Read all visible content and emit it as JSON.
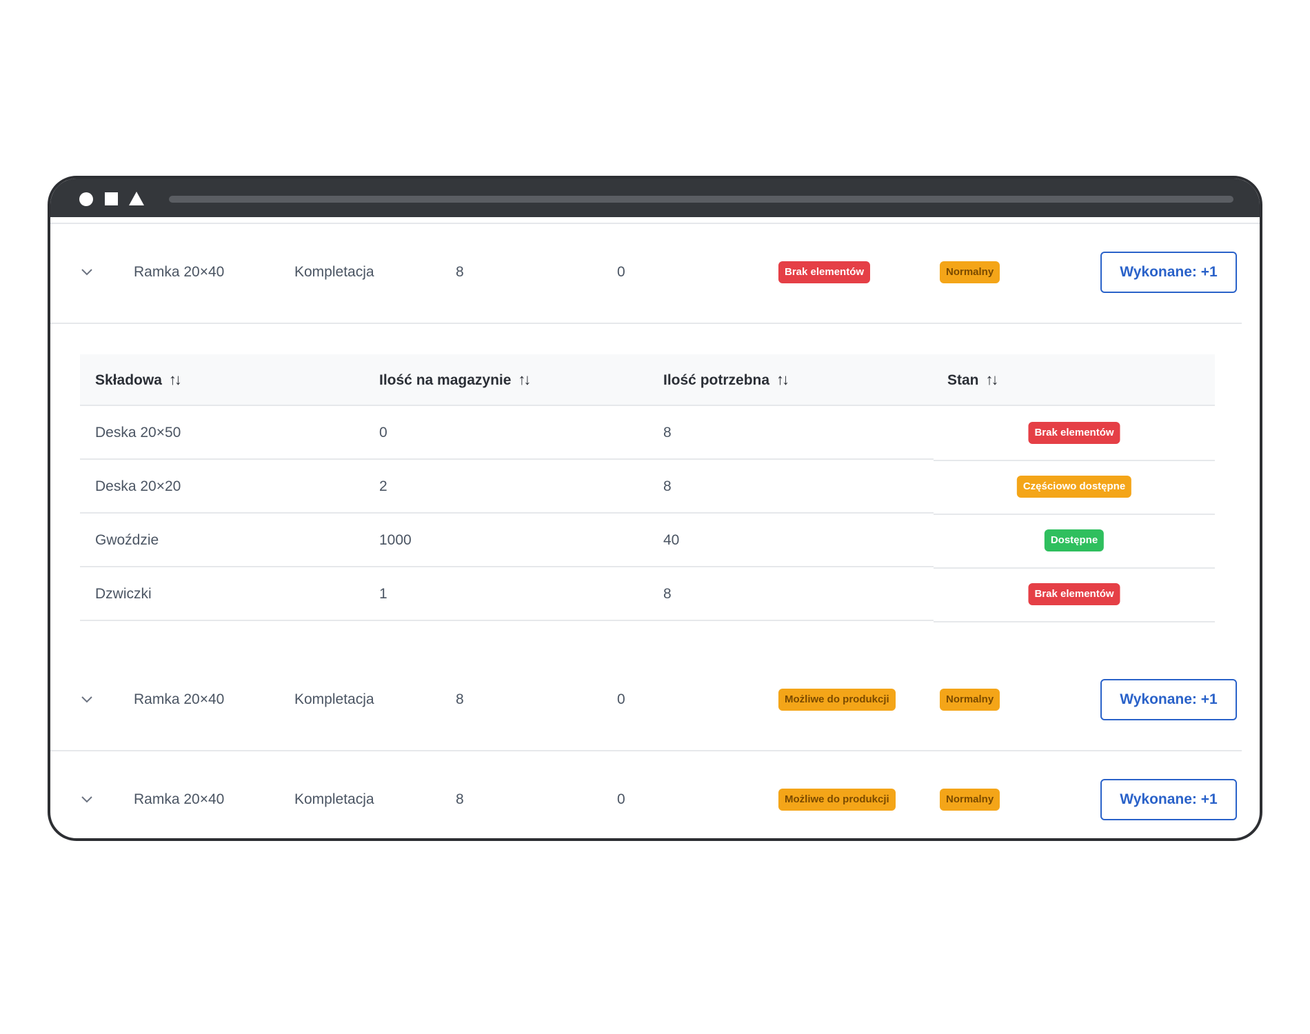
{
  "orders": [
    {
      "name": "Ramka 20×40",
      "type": "Kompletacja",
      "qty": "8",
      "done": "0",
      "status": "Brak elementów",
      "status_color": "#e53f46",
      "priority": "Normalny",
      "button": "Wykonane: +1"
    },
    {
      "name": "Ramka 20×40",
      "type": "Kompletacja",
      "qty": "8",
      "done": "0",
      "status": "Możliwe do produkcji",
      "status_color": "#f4a518",
      "priority": "Normalny",
      "button": "Wykonane: +1"
    },
    {
      "name": "Ramka 20×40",
      "type": "Kompletacja",
      "qty": "8",
      "done": "0",
      "status": "Możliwe do produkcji",
      "status_color": "#f4a518",
      "priority": "Normalny",
      "button": "Wykonane: +1"
    }
  ],
  "components": {
    "headers": [
      "Składowa",
      "Ilość na magazynie",
      "Ilość potrzebna",
      "Stan"
    ],
    "sort_icon": "↑↓",
    "rows": [
      {
        "name": "Deska 20×50",
        "stock": "0",
        "needed": "8",
        "state": "Brak elementów",
        "state_color": "#e53f46"
      },
      {
        "name": "Deska 20×20",
        "stock": "2",
        "needed": "8",
        "state": "Częściowo dostępne",
        "state_color": "#f4a518"
      },
      {
        "name": "Gwoździe",
        "stock": "1000",
        "needed": "40",
        "state": "Dostępne",
        "state_color": "#2fbf5e"
      },
      {
        "name": "Dzwiczki",
        "stock": "1",
        "needed": "8",
        "state": "Brak elementów",
        "state_color": "#e53f46"
      }
    ]
  },
  "colors": {
    "accent": "#2a62c9",
    "titlebar": "#34373b"
  }
}
